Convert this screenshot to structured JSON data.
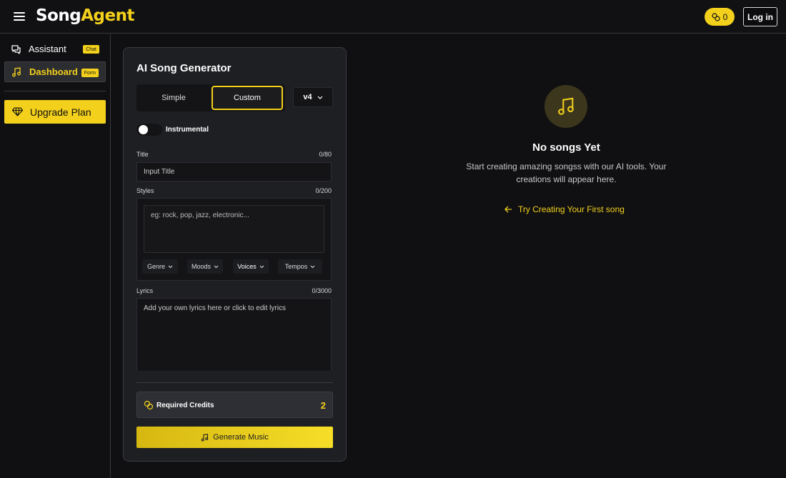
{
  "header": {
    "logo_part1": "Song",
    "logo_part2": "Agent",
    "credits_count": "0",
    "login_label": "Log in"
  },
  "sidebar": {
    "items": [
      {
        "label": "Assistant",
        "badge": "Chat",
        "icon": "chat-bubble-icon"
      },
      {
        "label": "Dashboard",
        "badge": "Form",
        "icon": "music-note-icon"
      }
    ],
    "upgrade_label": "Upgrade Plan",
    "upgrade_icon": "diamond-icon"
  },
  "generator": {
    "title": "AI Song Generator",
    "modes": {
      "simple": "Simple",
      "custom": "Custom"
    },
    "version": "v4",
    "instrumental_label": "Instrumental",
    "title_field": {
      "label": "Title",
      "count": "0/80",
      "placeholder": "Input Title"
    },
    "styles_field": {
      "label": "Styles",
      "count": "0/200",
      "placeholder": "eg: rock, pop, jazz, electronic..."
    },
    "style_chips": [
      "Genre",
      "Moods",
      "Voices",
      "Tempos"
    ],
    "lyrics_field": {
      "label": "Lyrics",
      "count": "0/3000",
      "placeholder": "Add your own lyrics here or click to edit lyrics"
    },
    "credits_label": "Required Credits",
    "credits_value": "2",
    "generate_label": "Generate Music"
  },
  "empty_state": {
    "title": "No songs Yet",
    "description": "Start creating amazing songss with our AI tools. Your creations will appear here.",
    "link": "Try Creating Your First song"
  },
  "colors": {
    "accent": "#f3d01c",
    "background": "#101012",
    "panel": "#1e1f23"
  }
}
